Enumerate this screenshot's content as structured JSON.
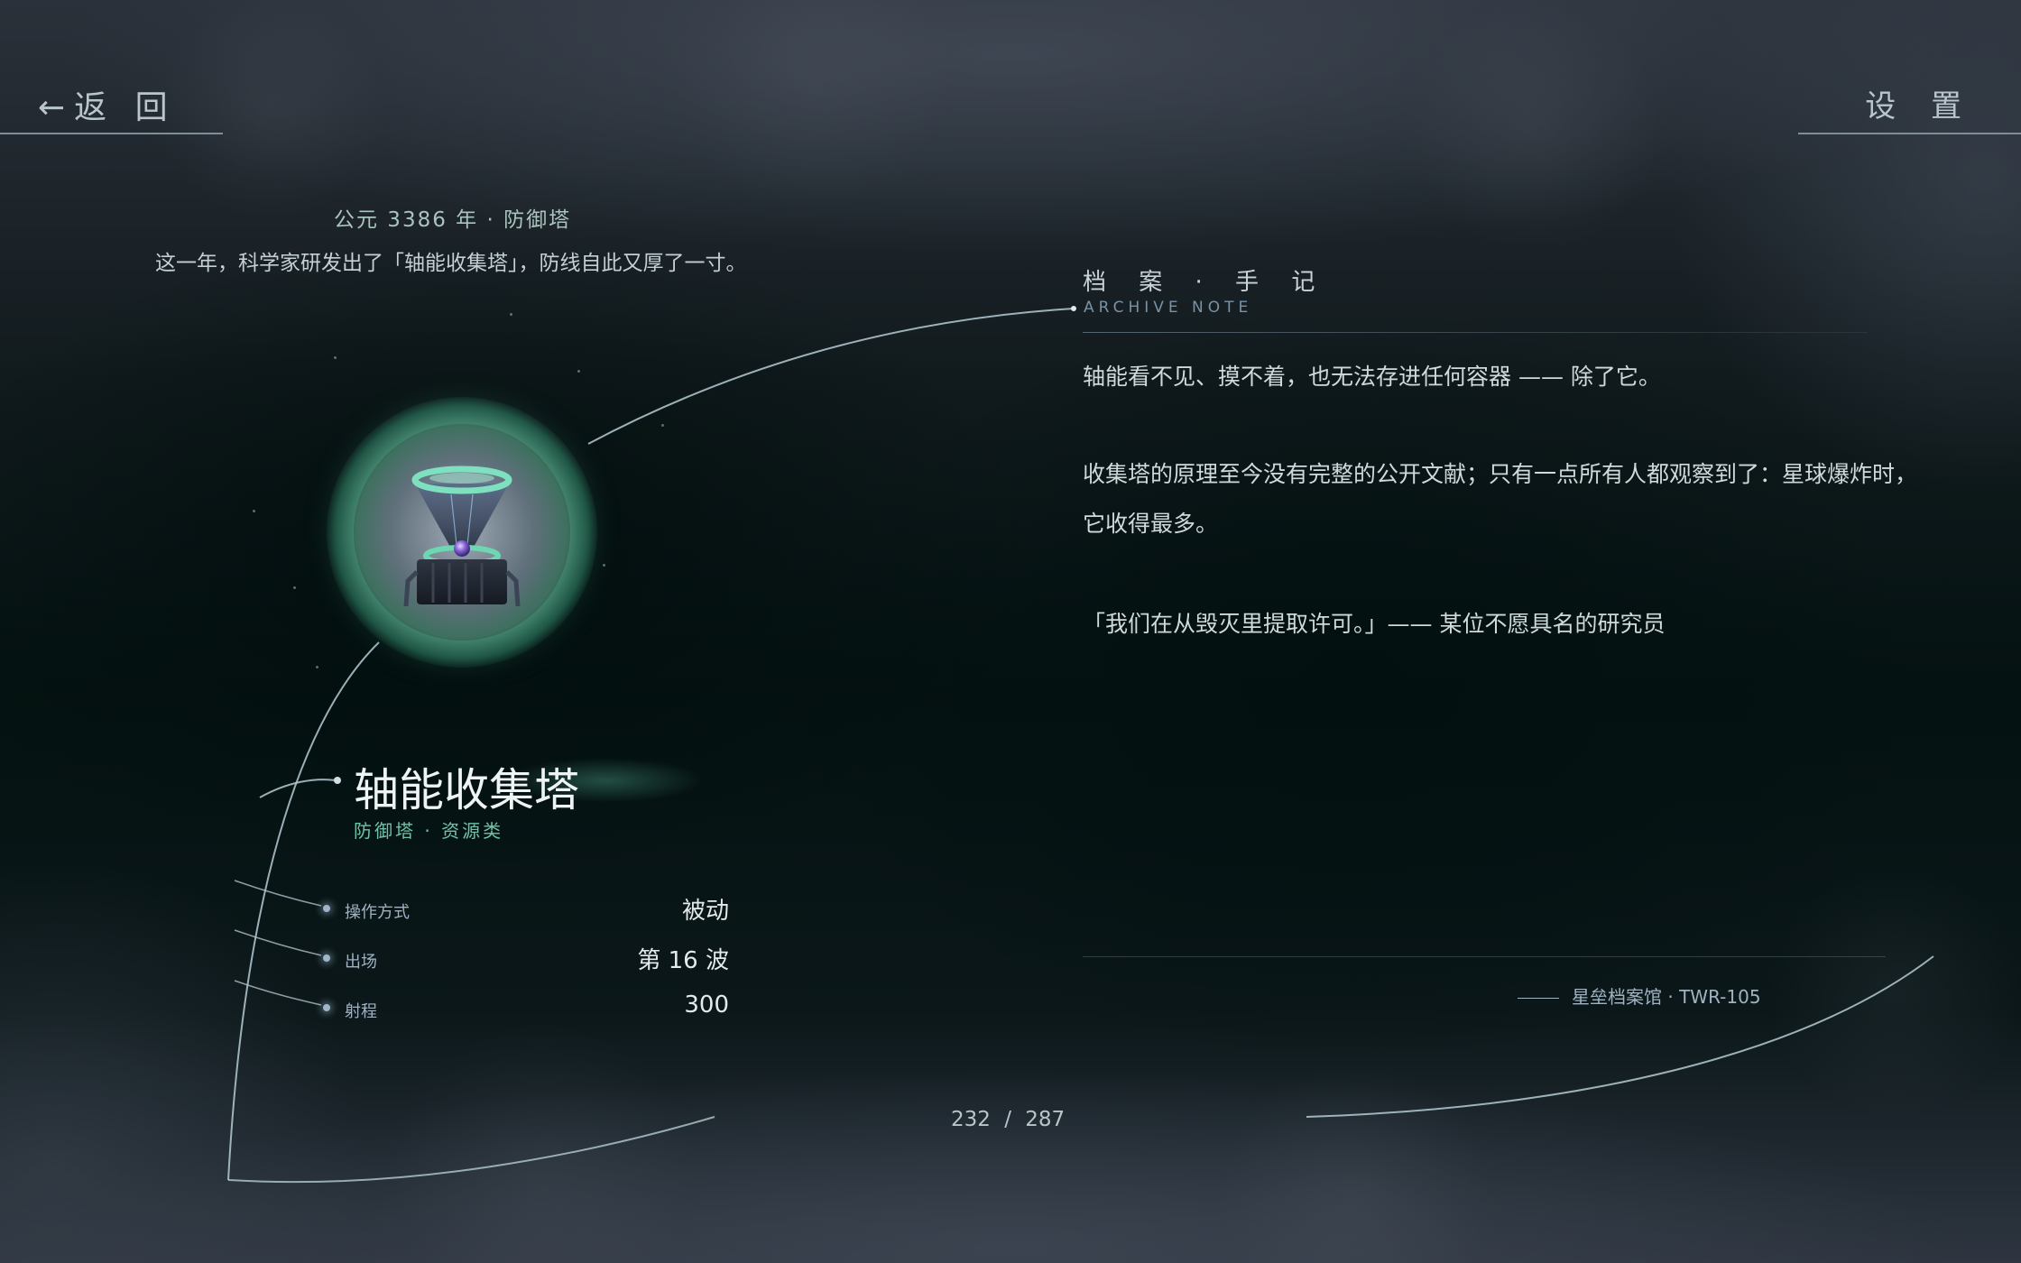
{
  "nav": {
    "back_label": "←返 回",
    "settings_label": "设 置"
  },
  "header": {
    "era": "公元 3386 年 · 防御塔",
    "intro": "这一年，科学家研发出了「轴能收集塔」，防线自此又厚了一寸。"
  },
  "tower": {
    "icon": "axis-energy-collector-tower-icon",
    "name": "轴能收集塔",
    "category": "防御塔 · 资源类",
    "stats": [
      {
        "label": "操作方式",
        "value": "被动"
      },
      {
        "label": "出场",
        "value": "第 16 波"
      },
      {
        "label": "射程",
        "value": "300"
      }
    ]
  },
  "archive": {
    "title": "档 案 · 手 记",
    "subtitle": "ARCHIVE NOTE",
    "paragraphs": [
      "轴能看不见、摸不着，也无法存进任何容器 —— 除了它。",
      "收集塔的原理至今没有完整的公开文献；只有一点所有人都观察到了：星球爆炸时，它收得最多。",
      "「我们在从毁灭里提取许可。」—— 某位不愿具名的研究员"
    ],
    "signature": "星垒档案馆 · TWR-105"
  },
  "pager": {
    "current": "232",
    "separator": "/",
    "total": "287"
  },
  "colors": {
    "accent": "#6fc4a8",
    "glow": "#5ac8a0",
    "line": "#b5cbd3"
  }
}
